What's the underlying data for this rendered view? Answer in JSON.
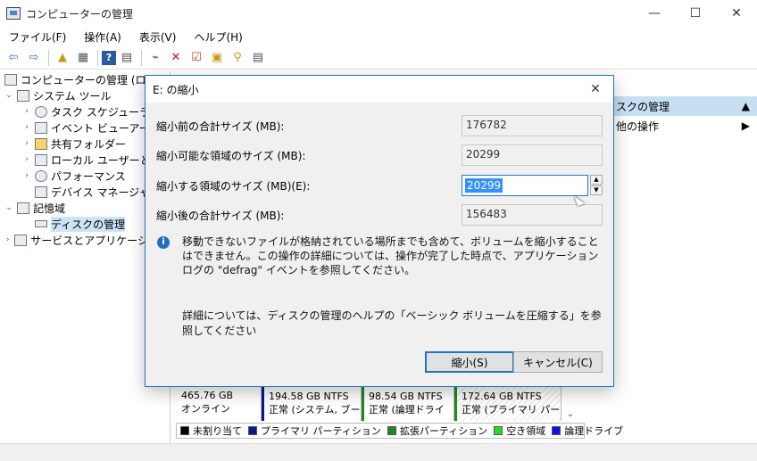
{
  "window": {
    "title": "コンピューターの管理",
    "minimize": "—",
    "maximize": "☐",
    "close": "✕"
  },
  "menu": [
    "ファイル(F)",
    "操作(A)",
    "表示(V)",
    "ヘルプ(H)"
  ],
  "toolbar": {
    "back_icon": "back-arrow-icon",
    "forward_icon": "forward-arrow-icon"
  },
  "tree": {
    "root": "コンピューターの管理 (ローカル",
    "system_tools": "システム ツール",
    "task_scheduler": "タスク スケジューラ",
    "event_viewer": "イベント ビューアー",
    "shared_folders": "共有フォルダー",
    "local_users": "ローカル ユーザーとグ",
    "performance": "パフォーマンス",
    "device_manager": "デバイス マネージャー",
    "storage": "記憶域",
    "disk_management": "ディスクの管理",
    "services": "サービスとアプリケーション"
  },
  "actions": {
    "header": "ィスクの管理",
    "other": "他の操作"
  },
  "disk": {
    "size": "465.76 GB",
    "status": "オンライン",
    "partitions": [
      {
        "size": "194.58 GB NTFS",
        "status": "正常 (システム, ブート,"
      },
      {
        "size": "98.54 GB NTFS",
        "status": "正常 (論理ドライ"
      },
      {
        "size": "172.64 GB NTFS",
        "status": "正常 (プライマリ パー"
      }
    ]
  },
  "legend": [
    {
      "label": "未割り当て",
      "color": "#000000"
    },
    {
      "label": "プライマリ パーティション",
      "color": "#0a1a8a"
    },
    {
      "label": "拡張パーティション",
      "color": "#1e8a1e"
    },
    {
      "label": "空き領域",
      "color": "#22dd22"
    },
    {
      "label": "論理ドライブ",
      "color": "#1010ee"
    }
  ],
  "dialog": {
    "title": "E: の縮小",
    "fields": [
      {
        "label": "縮小前の合計サイズ (MB):",
        "value": "176782"
      },
      {
        "label": "縮小可能な領域のサイズ (MB):",
        "value": "20299"
      },
      {
        "label": "縮小する領域のサイズ (MB)(E):",
        "value": "20299"
      },
      {
        "label": "縮小後の合計サイズ (MB):",
        "value": "156483"
      }
    ],
    "info": "移動できないファイルが格納されている場所までも含めて、ボリュームを縮小することはできません。この操作の詳細については、操作が完了した時点で、アプリケーション ログの \"defrag\" イベントを参照してください。",
    "help": "詳細については、ディスクの管理のヘルプの「ベーシック ボリュームを圧縮する」を参照してください",
    "shrink_button": "縮小(S)",
    "cancel_button": "キャンセル(C)"
  }
}
